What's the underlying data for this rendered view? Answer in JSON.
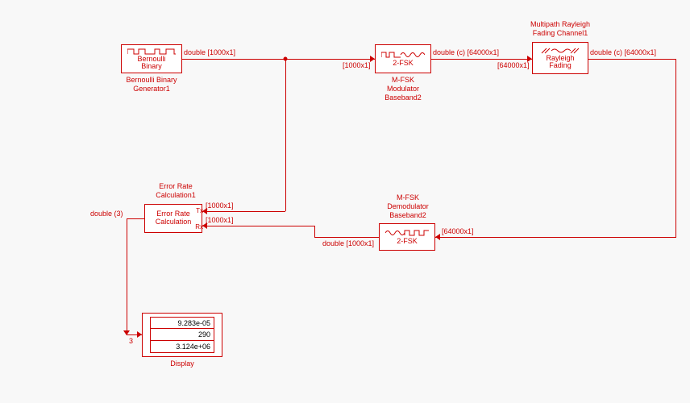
{
  "blocks": {
    "bernoulli": {
      "title": "Bernoulli\nBinary",
      "label": "Bernoulli Binary\nGenerator1"
    },
    "modulator": {
      "title": "2-FSK",
      "label": "M-FSK\nModulator\nBaseband2"
    },
    "channel": {
      "title": "Rayleigh\nFading",
      "label_top": "Multipath Rayleigh\nFading Channel1"
    },
    "demod": {
      "title": "2-FSK",
      "label": "M-FSK\nDemodulator\nBaseband2"
    },
    "err": {
      "title": "Error Rate\nCalculation",
      "label": "Error Rate\nCalculation1",
      "port_tx": "Tx",
      "port_rx": "Rx"
    },
    "display": {
      "label": "Display",
      "rows": [
        "9.283e-05",
        "290",
        "3.124e+06"
      ]
    }
  },
  "wires": {
    "bern_out": "double [1000x1]",
    "mod_in": "[1000x1]",
    "mod_out": "double (c) [64000x1]",
    "chan_in": "[64000x1]",
    "chan_out": "double (c) [64000x1]",
    "demod_in": "[64000x1]",
    "demod_out": "double [1000x1]",
    "err_tx": "[1000x1]",
    "err_rx": "[1000x1]",
    "err_out": "double (3)",
    "disp_in": "3"
  }
}
